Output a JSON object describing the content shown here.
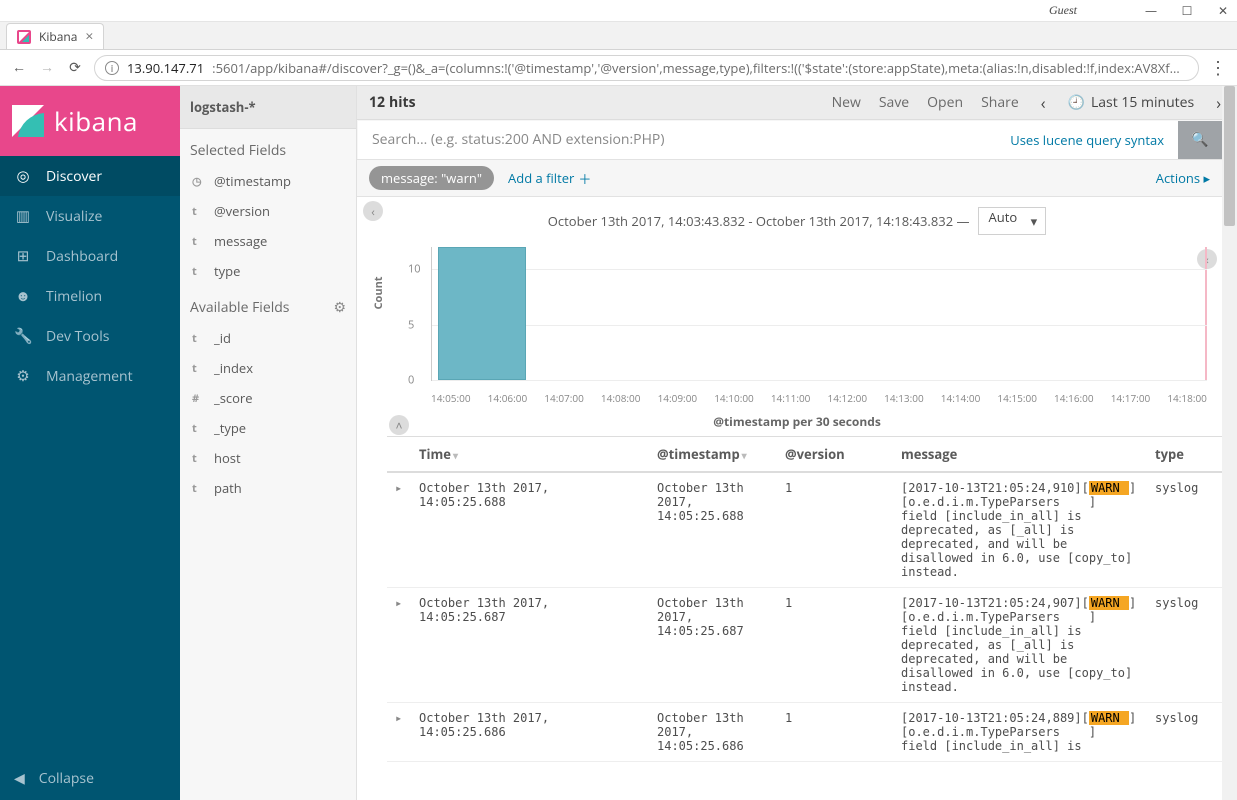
{
  "window": {
    "guest_label": "Guest",
    "min": "—",
    "max": "☐",
    "close": "✕"
  },
  "browser": {
    "tab": {
      "title": "Kibana"
    },
    "url_host": "13.90.147.71",
    "url_port_path": ":5601/app/kibana#/discover?_g=()&_a=(columns:!('@timestamp','@version',message,type),filters:!(('$state':(store:appState),meta:(alias:!n,disabled:!f,index:AV8Xf…"
  },
  "brand": "kibana",
  "nav": [
    {
      "icon": "◎",
      "label": "Discover",
      "active": true
    },
    {
      "icon": "▥",
      "label": "Visualize",
      "active": false
    },
    {
      "icon": "⊞",
      "label": "Dashboard",
      "active": false
    },
    {
      "icon": "☻",
      "label": "Timelion",
      "active": false
    },
    {
      "icon": "🔧",
      "label": "Dev Tools",
      "active": false
    },
    {
      "icon": "⚙",
      "label": "Management",
      "active": false
    }
  ],
  "collapse_label": "Collapse",
  "fields": {
    "index": "logstash-*",
    "selected_h": "Selected Fields",
    "selected": [
      {
        "t": "◷",
        "name": "@timestamp"
      },
      {
        "t": "t",
        "name": "@version"
      },
      {
        "t": "t",
        "name": "message"
      },
      {
        "t": "t",
        "name": "type"
      }
    ],
    "available_h": "Available Fields",
    "available": [
      {
        "t": "t",
        "name": "_id"
      },
      {
        "t": "t",
        "name": "_index"
      },
      {
        "t": "#",
        "name": "_score"
      },
      {
        "t": "t",
        "name": "_type"
      },
      {
        "t": "t",
        "name": "host"
      },
      {
        "t": "t",
        "name": "path"
      }
    ]
  },
  "topbar": {
    "hits_num": "12",
    "hits_label": "hits",
    "new": "New",
    "save": "Save",
    "open": "Open",
    "share": "Share",
    "time_label": "Last 15 minutes"
  },
  "search": {
    "placeholder": "Search… (e.g. status:200 AND extension:PHP)",
    "lucene": "Uses lucene query syntax"
  },
  "filters": {
    "pill": "message: \"warn\"",
    "add": "Add a filter",
    "actions": "Actions"
  },
  "date_range": "October 13th 2017, 14:03:43.832 - October 13th 2017, 14:18:43.832 —",
  "interval": "Auto",
  "chart_data": {
    "type": "bar",
    "title": "",
    "ylabel": "Count",
    "xlabel": "@timestamp per 30 seconds",
    "ylim": [
      0,
      12
    ],
    "yticks": [
      0,
      5,
      10
    ],
    "categories": [
      "14:05:00",
      "14:06:00",
      "14:07:00",
      "14:08:00",
      "14:09:00",
      "14:10:00",
      "14:11:00",
      "14:12:00",
      "14:13:00",
      "14:14:00",
      "14:15:00",
      "14:16:00",
      "14:17:00",
      "14:18:00"
    ],
    "values": [
      12,
      0,
      0,
      0,
      0,
      0,
      0,
      0,
      0,
      0,
      0,
      0,
      0,
      0
    ]
  },
  "columns": {
    "time": "Time",
    "ts": "@timestamp",
    "ver": "@version",
    "msg": "message",
    "type": "type"
  },
  "docs": [
    {
      "time": "October 13th 2017, 14:05:25.688",
      "ts": "October 13th 2017, 14:05:25.688",
      "ver": "1",
      "msg_pre": "[2017-10-13T21:05:24,910][",
      "msg_hl": "WARN ",
      "msg_post": "][o.e.d.i.m.TypeParsers    ] field [include_in_all] is deprecated, as [_all] is deprecated, and will be disallowed in 6.0, use [copy_to] instead.",
      "type": "syslog"
    },
    {
      "time": "October 13th 2017, 14:05:25.687",
      "ts": "October 13th 2017, 14:05:25.687",
      "ver": "1",
      "msg_pre": "[2017-10-13T21:05:24,907][",
      "msg_hl": "WARN ",
      "msg_post": "][o.e.d.i.m.TypeParsers    ] field [include_in_all] is deprecated, as [_all] is deprecated, and will be disallowed in 6.0, use [copy_to] instead.",
      "type": "syslog"
    },
    {
      "time": "October 13th 2017, 14:05:25.686",
      "ts": "October 13th 2017, 14:05:25.686",
      "ver": "1",
      "msg_pre": "[2017-10-13T21:05:24,889][",
      "msg_hl": "WARN ",
      "msg_post": "][o.e.d.i.m.TypeParsers    ] field [include_in_all] is",
      "type": "syslog"
    }
  ]
}
